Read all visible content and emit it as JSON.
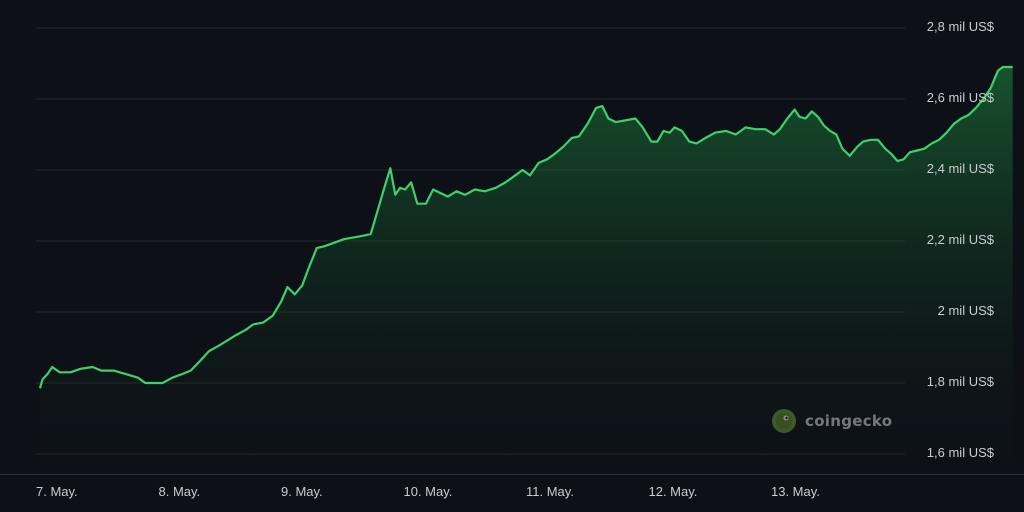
{
  "chart_data": {
    "type": "area",
    "title": "",
    "xlabel": "",
    "ylabel": "",
    "unit": "US$",
    "ylim": [
      1550,
      2800
    ],
    "grid": true,
    "y_ticks": [
      {
        "value": 2800,
        "label": "2,8 mil US$"
      },
      {
        "value": 2600,
        "label": "2,6 mil US$"
      },
      {
        "value": 2400,
        "label": "2,4 mil US$"
      },
      {
        "value": 2200,
        "label": "2,2 mil US$"
      },
      {
        "value": 2000,
        "label": "2 mil US$"
      },
      {
        "value": 1800,
        "label": "1,8 mil US$"
      },
      {
        "value": 1600,
        "label": "1,6 mil US$"
      }
    ],
    "x_ticks": [
      {
        "day": 0,
        "label": "7. May."
      },
      {
        "day": 1,
        "label": "8. May."
      },
      {
        "day": 2,
        "label": "9. May."
      },
      {
        "day": 3,
        "label": "10. May."
      },
      {
        "day": 4,
        "label": "11. May."
      },
      {
        "day": 5,
        "label": "12. May."
      },
      {
        "day": 6,
        "label": "13. May."
      }
    ],
    "series": [
      {
        "color": "#3dd16a",
        "points": [
          [
            0.0,
            1785
          ],
          [
            0.02,
            1810
          ],
          [
            0.06,
            1825
          ],
          [
            0.1,
            1845
          ],
          [
            0.16,
            1830
          ],
          [
            0.25,
            1830
          ],
          [
            0.33,
            1840
          ],
          [
            0.43,
            1845
          ],
          [
            0.5,
            1835
          ],
          [
            0.6,
            1835
          ],
          [
            0.7,
            1825
          ],
          [
            0.8,
            1815
          ],
          [
            0.86,
            1800
          ],
          [
            0.92,
            1800
          ],
          [
            1.0,
            1800
          ],
          [
            1.08,
            1815
          ],
          [
            1.16,
            1825
          ],
          [
            1.23,
            1835
          ],
          [
            1.3,
            1860
          ],
          [
            1.38,
            1890
          ],
          [
            1.46,
            1905
          ],
          [
            1.53,
            1920
          ],
          [
            1.6,
            1935
          ],
          [
            1.68,
            1950
          ],
          [
            1.74,
            1965
          ],
          [
            1.82,
            1970
          ],
          [
            1.9,
            1990
          ],
          [
            1.97,
            2030
          ],
          [
            2.02,
            2070
          ],
          [
            2.08,
            2050
          ],
          [
            2.14,
            2075
          ],
          [
            2.2,
            2130
          ],
          [
            2.26,
            2180
          ],
          [
            2.32,
            2185
          ],
          [
            2.4,
            2195
          ],
          [
            2.48,
            2205
          ],
          [
            2.56,
            2210
          ],
          [
            2.64,
            2215
          ],
          [
            2.7,
            2220
          ],
          [
            2.76,
            2290
          ],
          [
            2.82,
            2360
          ],
          [
            2.86,
            2405
          ],
          [
            2.9,
            2330
          ],
          [
            2.94,
            2350
          ],
          [
            2.98,
            2345
          ],
          [
            3.03,
            2365
          ],
          [
            3.08,
            2305
          ],
          [
            3.15,
            2305
          ],
          [
            3.21,
            2345
          ],
          [
            3.27,
            2335
          ],
          [
            3.33,
            2325
          ],
          [
            3.4,
            2340
          ],
          [
            3.47,
            2330
          ],
          [
            3.55,
            2345
          ],
          [
            3.63,
            2340
          ],
          [
            3.72,
            2350
          ],
          [
            3.8,
            2365
          ],
          [
            3.88,
            2385
          ],
          [
            3.94,
            2400
          ],
          [
            4.0,
            2385
          ],
          [
            4.07,
            2420
          ],
          [
            4.14,
            2430
          ],
          [
            4.2,
            2445
          ],
          [
            4.27,
            2465
          ],
          [
            4.34,
            2490
          ],
          [
            4.4,
            2495
          ],
          [
            4.47,
            2530
          ],
          [
            4.54,
            2575
          ],
          [
            4.59,
            2580
          ],
          [
            4.64,
            2545
          ],
          [
            4.7,
            2535
          ],
          [
            4.78,
            2540
          ],
          [
            4.86,
            2545
          ],
          [
            4.92,
            2520
          ],
          [
            4.99,
            2480
          ],
          [
            5.04,
            2480
          ],
          [
            5.09,
            2510
          ],
          [
            5.14,
            2505
          ],
          [
            5.18,
            2520
          ],
          [
            5.24,
            2510
          ],
          [
            5.3,
            2480
          ],
          [
            5.36,
            2475
          ],
          [
            5.43,
            2490
          ],
          [
            5.51,
            2505
          ],
          [
            5.6,
            2510
          ],
          [
            5.68,
            2500
          ],
          [
            5.76,
            2520
          ],
          [
            5.84,
            2515
          ],
          [
            5.92,
            2515
          ],
          [
            5.99,
            2500
          ],
          [
            6.04,
            2515
          ],
          [
            6.1,
            2545
          ],
          [
            6.16,
            2570
          ],
          [
            6.2,
            2550
          ],
          [
            6.25,
            2545
          ],
          [
            6.3,
            2565
          ],
          [
            6.35,
            2550
          ],
          [
            6.4,
            2525
          ],
          [
            6.45,
            2510
          ],
          [
            6.5,
            2500
          ],
          [
            6.55,
            2460
          ],
          [
            6.61,
            2440
          ],
          [
            6.67,
            2465
          ],
          [
            6.72,
            2480
          ],
          [
            6.78,
            2485
          ],
          [
            6.84,
            2485
          ],
          [
            6.9,
            2460
          ],
          [
            6.95,
            2445
          ],
          [
            7.0,
            2425
          ],
          [
            7.05,
            2430
          ],
          [
            7.1,
            2450
          ],
          [
            7.16,
            2455
          ],
          [
            7.22,
            2460
          ],
          [
            7.28,
            2475
          ],
          [
            7.34,
            2485
          ],
          [
            7.4,
            2505
          ],
          [
            7.46,
            2530
          ],
          [
            7.52,
            2545
          ],
          [
            7.58,
            2555
          ],
          [
            7.64,
            2575
          ],
          [
            7.7,
            2600
          ],
          [
            7.76,
            2630
          ],
          [
            7.82,
            2680
          ],
          [
            7.86,
            2690
          ],
          [
            7.9,
            2690
          ],
          [
            7.94,
            2690
          ]
        ]
      }
    ],
    "watermark": "coingecko"
  }
}
